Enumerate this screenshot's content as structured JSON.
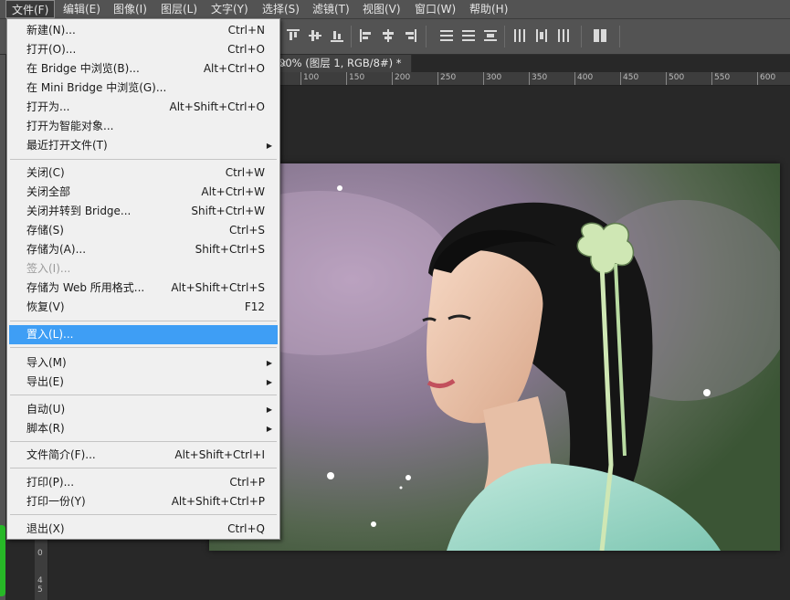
{
  "menubar": {
    "items": [
      "文件(F)",
      "编辑(E)",
      "图像(I)",
      "图层(L)",
      "文字(Y)",
      "选择(S)",
      "滤镜(T)",
      "视图(V)",
      "窗口(W)",
      "帮助(H)"
    ]
  },
  "document_tab": {
    "title": "00% (图层 1, RGB/8#) *",
    "close": "×"
  },
  "ruler": {
    "ticks": [
      "100",
      "150",
      "200",
      "250",
      "300",
      "350",
      "400",
      "450",
      "500",
      "550",
      "600"
    ],
    "vticks": [
      "0",
      "4",
      "5"
    ]
  },
  "file_menu": {
    "items": [
      {
        "label": "新建(N)...",
        "shortcut": "Ctrl+N"
      },
      {
        "label": "打开(O)...",
        "shortcut": "Ctrl+O"
      },
      {
        "label": "在 Bridge 中浏览(B)...",
        "shortcut": "Alt+Ctrl+O"
      },
      {
        "label": "在 Mini Bridge 中浏览(G)...",
        "shortcut": ""
      },
      {
        "label": "打开为...",
        "shortcut": "Alt+Shift+Ctrl+O"
      },
      {
        "label": "打开为智能对象...",
        "shortcut": ""
      },
      {
        "label": "最近打开文件(T)",
        "shortcut": "",
        "submenu": true
      },
      {
        "label": "关闭(C)",
        "shortcut": "Ctrl+W"
      },
      {
        "label": "关闭全部",
        "shortcut": "Alt+Ctrl+W"
      },
      {
        "label": "关闭并转到 Bridge...",
        "shortcut": "Shift+Ctrl+W"
      },
      {
        "label": "存储(S)",
        "shortcut": "Ctrl+S"
      },
      {
        "label": "存储为(A)...",
        "shortcut": "Shift+Ctrl+S"
      },
      {
        "label": "签入(I)...",
        "shortcut": "",
        "disabled": true
      },
      {
        "label": "存储为 Web 所用格式...",
        "shortcut": "Alt+Shift+Ctrl+S"
      },
      {
        "label": "恢复(V)",
        "shortcut": "F12"
      },
      {
        "label": "置入(L)...",
        "shortcut": "",
        "highlighted": true
      },
      {
        "label": "导入(M)",
        "shortcut": "",
        "submenu": true
      },
      {
        "label": "导出(E)",
        "shortcut": "",
        "submenu": true
      },
      {
        "label": "自动(U)",
        "shortcut": "",
        "submenu": true
      },
      {
        "label": "脚本(R)",
        "shortcut": "",
        "submenu": true
      },
      {
        "label": "文件简介(F)...",
        "shortcut": "Alt+Shift+Ctrl+I"
      },
      {
        "label": "打印(P)...",
        "shortcut": "Ctrl+P"
      },
      {
        "label": "打印一份(Y)",
        "shortcut": "Alt+Shift+Ctrl+P"
      },
      {
        "label": "退出(X)",
        "shortcut": "Ctrl+Q"
      }
    ],
    "submenu_arrow": "▶"
  },
  "colors": {
    "highlight": "#3e9ef5",
    "menu_bg": "#f0f0f0",
    "app_bg": "#282828",
    "panel": "#535353"
  }
}
